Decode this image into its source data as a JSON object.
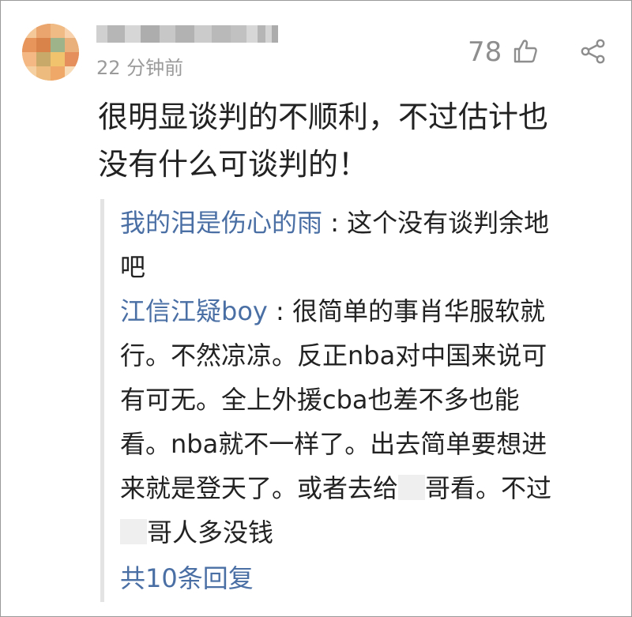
{
  "comment": {
    "username": "",
    "timestamp": "22 分钟前",
    "like_count": "78",
    "body_lines": [
      "很明显谈判的不顺利，不过估计也",
      "没有什么可谈判的！"
    ]
  },
  "replies": [
    {
      "name": "我的泪是伤心的雨",
      "separator": " : ",
      "first": "这个没有谈判余地",
      "rest": [
        "吧"
      ]
    },
    {
      "name": "江信江疑boy",
      "separator": " : ",
      "first": "很简单的事肖华服软就",
      "rest": [
        "行。不然凉凉。反正nba对中国来说可",
        "有可无。全上外援cba也差不多也能",
        "看。nba就不一样了。出去简单要想进"
      ],
      "line6_a": "来就是登天了。或者去给",
      "line6_b": "哥看。不过",
      "line7": "哥人多没钱"
    }
  ],
  "more_replies": "共10条回复",
  "colors": {
    "link": "#4a6fa5",
    "text": "#222222",
    "meta": "#9b9b9b"
  },
  "icons": {
    "like": "thumbs-up-icon",
    "share": "share-icon"
  }
}
